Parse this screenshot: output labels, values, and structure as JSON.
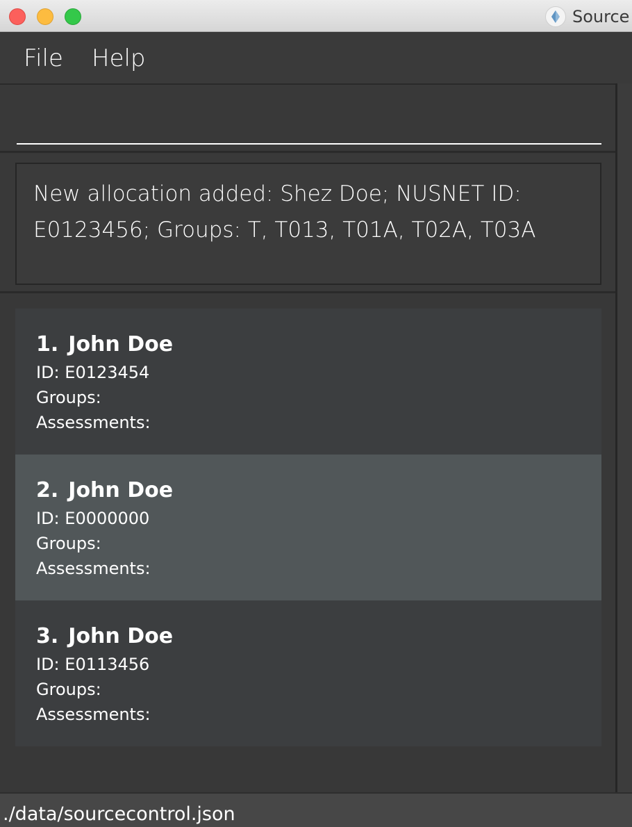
{
  "window": {
    "title": "Source",
    "icon": "app-logo-icon"
  },
  "menu": {
    "file": "File",
    "help": "Help"
  },
  "command": {
    "value": ""
  },
  "result": {
    "message": "New allocation added: Shez Doe; NUSNET ID: E0123456; Groups: T, T013, T01A, T02A, T03A"
  },
  "students": [
    {
      "index": "1.",
      "name": "John Doe",
      "id": "ID: E0123454",
      "groups": "Groups:",
      "assessments": "Assessments:"
    },
    {
      "index": "2.",
      "name": "John Doe",
      "id": "ID: E0000000",
      "groups": "Groups:",
      "assessments": "Assessments:"
    },
    {
      "index": "3.",
      "name": "John Doe",
      "id": "ID: E0113456",
      "groups": "Groups:",
      "assessments": "Assessments:"
    }
  ],
  "status": {
    "path": "./data/sourcecontrol.json"
  },
  "colors": {
    "background": "#3a3a3a",
    "card": "#3c3e40",
    "card_selected": "#515759"
  }
}
